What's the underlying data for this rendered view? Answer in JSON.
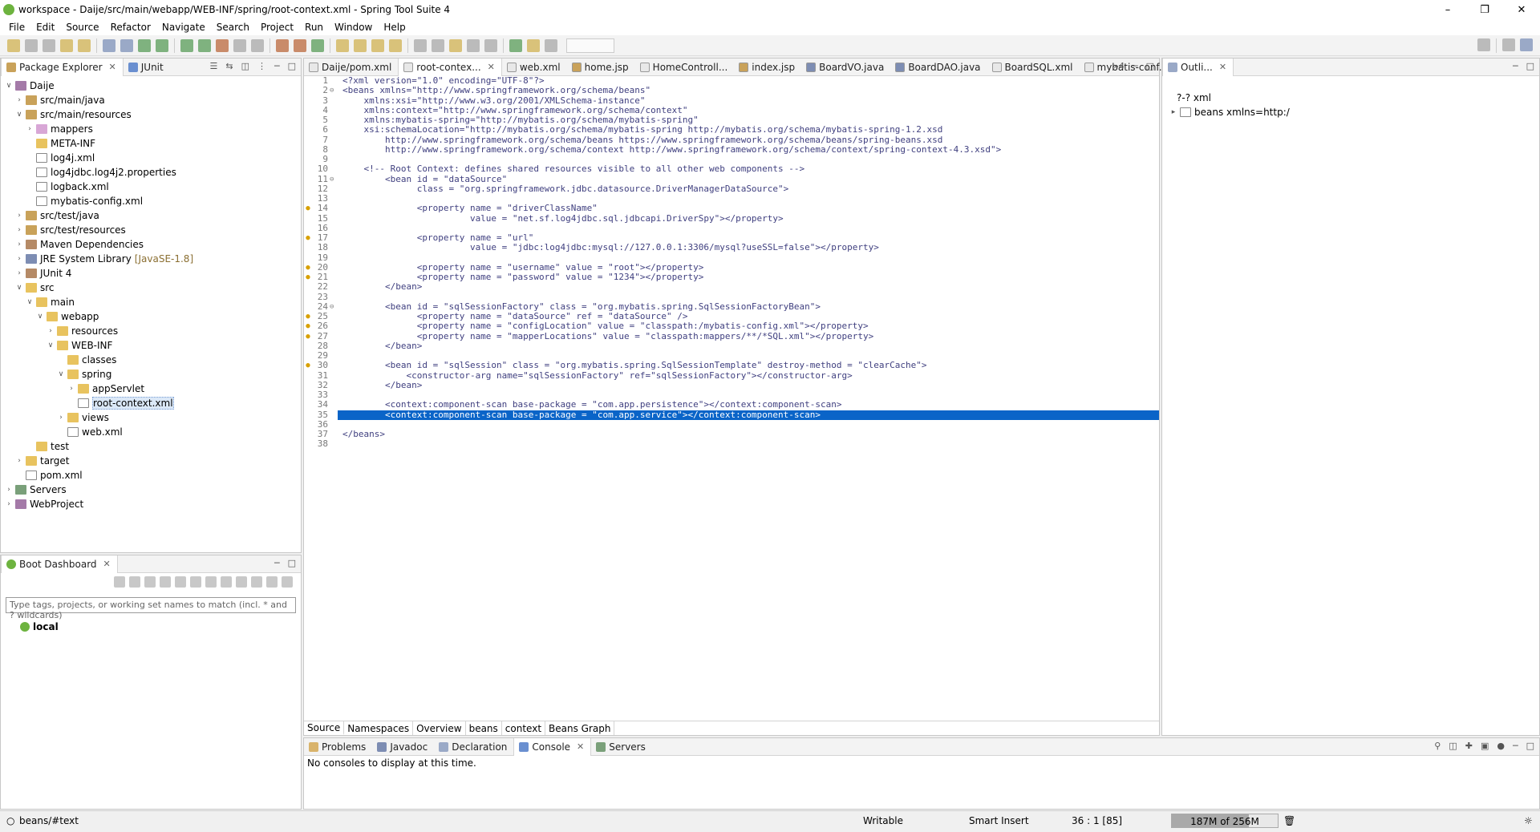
{
  "window": {
    "title": "workspace - Daije/src/main/webapp/WEB-INF/spring/root-context.xml - Spring Tool Suite 4"
  },
  "menu": [
    "File",
    "Edit",
    "Source",
    "Refactor",
    "Navigate",
    "Search",
    "Project",
    "Run",
    "Window",
    "Help"
  ],
  "explorer": {
    "tabs": [
      {
        "label": "Package Explorer"
      },
      {
        "label": "JUnit"
      }
    ],
    "tree": [
      {
        "label": "Daije",
        "indent": 0,
        "icon": "project-icon",
        "twisty": "open"
      },
      {
        "label": "src/main/java",
        "indent": 1,
        "icon": "package-folder-icon",
        "twisty": "closed"
      },
      {
        "label": "src/main/resources",
        "indent": 1,
        "icon": "package-folder-icon",
        "twisty": "open"
      },
      {
        "label": "mappers",
        "indent": 2,
        "icon": "package-icon",
        "twisty": "closed"
      },
      {
        "label": "META-INF",
        "indent": 2,
        "icon": "folder-icon",
        "twisty": ""
      },
      {
        "label": "log4j.xml",
        "indent": 2,
        "icon": "xml-file-icon",
        "twisty": ""
      },
      {
        "label": "log4jdbc.log4j2.properties",
        "indent": 2,
        "icon": "xml-file-icon",
        "twisty": ""
      },
      {
        "label": "logback.xml",
        "indent": 2,
        "icon": "xml-file-icon",
        "twisty": ""
      },
      {
        "label": "mybatis-config.xml",
        "indent": 2,
        "icon": "xml-file-icon",
        "twisty": ""
      },
      {
        "label": "src/test/java",
        "indent": 1,
        "icon": "package-folder-icon",
        "twisty": "closed"
      },
      {
        "label": "src/test/resources",
        "indent": 1,
        "icon": "package-folder-icon",
        "twisty": "closed"
      },
      {
        "label": "Maven Dependencies",
        "indent": 1,
        "icon": "library-icon",
        "twisty": "closed"
      },
      {
        "label": "JRE System Library",
        "decor": "[JavaSE-1.8]",
        "indent": 1,
        "icon": "jre-library-icon",
        "twisty": "closed"
      },
      {
        "label": "JUnit 4",
        "indent": 1,
        "icon": "library-icon",
        "twisty": "closed"
      },
      {
        "label": "src",
        "indent": 1,
        "icon": "folder-icon",
        "twisty": "open"
      },
      {
        "label": "main",
        "indent": 2,
        "icon": "folder-icon",
        "twisty": "open"
      },
      {
        "label": "webapp",
        "indent": 3,
        "icon": "folder-icon",
        "twisty": "open"
      },
      {
        "label": "resources",
        "indent": 4,
        "icon": "folder-icon",
        "twisty": "closed"
      },
      {
        "label": "WEB-INF",
        "indent": 4,
        "icon": "folder-icon",
        "twisty": "open"
      },
      {
        "label": "classes",
        "indent": 5,
        "icon": "folder-icon",
        "twisty": ""
      },
      {
        "label": "spring",
        "indent": 5,
        "icon": "folder-icon",
        "twisty": "open"
      },
      {
        "label": "appServlet",
        "indent": 6,
        "icon": "folder-icon",
        "twisty": "closed"
      },
      {
        "label": "root-context.xml",
        "indent": 6,
        "icon": "xml-file-icon",
        "twisty": "",
        "selected": true
      },
      {
        "label": "views",
        "indent": 5,
        "icon": "folder-icon",
        "twisty": "closed"
      },
      {
        "label": "web.xml",
        "indent": 5,
        "icon": "xml-file-icon",
        "twisty": ""
      },
      {
        "label": "test",
        "indent": 2,
        "icon": "folder-icon",
        "twisty": ""
      },
      {
        "label": "target",
        "indent": 1,
        "icon": "folder-icon",
        "twisty": "closed"
      },
      {
        "label": "pom.xml",
        "indent": 1,
        "icon": "xml-file-icon",
        "twisty": ""
      },
      {
        "label": "Servers",
        "indent": 0,
        "icon": "server-project-icon",
        "twisty": "closed"
      },
      {
        "label": "WebProject",
        "indent": 0,
        "icon": "project-icon",
        "twisty": "closed"
      }
    ]
  },
  "boot": {
    "tab": "Boot Dashboard",
    "search_placeholder": "Type tags, projects, or working set names to match (incl. * and ? wildcards)",
    "local": "local"
  },
  "editor": {
    "tabs": [
      {
        "label": "Daije/pom.xml",
        "active": false
      },
      {
        "label": "root-contex...",
        "active": true
      },
      {
        "label": "web.xml",
        "active": false
      },
      {
        "label": "home.jsp",
        "active": false
      },
      {
        "label": "HomeControll...",
        "active": false
      },
      {
        "label": "index.jsp",
        "active": false
      },
      {
        "label": "BoardVO.java",
        "active": false
      },
      {
        "label": "BoardDAO.java",
        "active": false
      },
      {
        "label": "BoardSQL.xml",
        "active": false
      },
      {
        "label": "mybatis-conf...",
        "active": false
      }
    ],
    "overflow": "»4",
    "lines": [
      {
        "n": "1",
        "m": "",
        "t": "<?xml version=\"1.0\" encoding=\"UTF-8\"?>"
      },
      {
        "n": "2",
        "m": "fold",
        "t": "<beans xmlns=\"http://www.springframework.org/schema/beans\""
      },
      {
        "n": "3",
        "m": "",
        "t": "    xmlns:xsi=\"http://www.w3.org/2001/XMLSchema-instance\""
      },
      {
        "n": "4",
        "m": "",
        "t": "    xmlns:context=\"http://www.springframework.org/schema/context\""
      },
      {
        "n": "5",
        "m": "",
        "t": "    xmlns:mybatis-spring=\"http://mybatis.org/schema/mybatis-spring\""
      },
      {
        "n": "6",
        "m": "",
        "t": "    xsi:schemaLocation=\"http://mybatis.org/schema/mybatis-spring http://mybatis.org/schema/mybatis-spring-1.2.xsd"
      },
      {
        "n": "7",
        "m": "",
        "t": "        http://www.springframework.org/schema/beans https://www.springframework.org/schema/beans/spring-beans.xsd"
      },
      {
        "n": "8",
        "m": "",
        "t": "        http://www.springframework.org/schema/context http://www.springframework.org/schema/context/spring-context-4.3.xsd\">"
      },
      {
        "n": "9",
        "m": "",
        "t": ""
      },
      {
        "n": "10",
        "m": "",
        "t": "    <!-- Root Context: defines shared resources visible to all other web components -->"
      },
      {
        "n": "11",
        "m": "fold",
        "t": "        <bean id = \"dataSource\""
      },
      {
        "n": "12",
        "m": "",
        "t": "              class = \"org.springframework.jdbc.datasource.DriverManagerDataSource\">"
      },
      {
        "n": "13",
        "m": "",
        "t": ""
      },
      {
        "n": "14",
        "m": "warn",
        "t": "              <property name = \"driverClassName\""
      },
      {
        "n": "15",
        "m": "",
        "t": "                        value = \"net.sf.log4jdbc.sql.jdbcapi.DriverSpy\"></property>"
      },
      {
        "n": "16",
        "m": "",
        "t": ""
      },
      {
        "n": "17",
        "m": "warn",
        "t": "              <property name = \"url\""
      },
      {
        "n": "18",
        "m": "",
        "t": "                        value = \"jdbc:log4jdbc:mysql://127.0.0.1:3306/mysql?useSSL=false\"></property>"
      },
      {
        "n": "19",
        "m": "",
        "t": ""
      },
      {
        "n": "20",
        "m": "warn",
        "t": "              <property name = \"username\" value = \"root\"></property>"
      },
      {
        "n": "21",
        "m": "warn",
        "t": "              <property name = \"password\" value = \"1234\"></property>"
      },
      {
        "n": "22",
        "m": "",
        "t": "        </bean>"
      },
      {
        "n": "23",
        "m": "",
        "t": ""
      },
      {
        "n": "24",
        "m": "fold",
        "t": "        <bean id = \"sqlSessionFactory\" class = \"org.mybatis.spring.SqlSessionFactoryBean\">"
      },
      {
        "n": "25",
        "m": "warn",
        "t": "              <property name = \"dataSource\" ref = \"dataSource\" />"
      },
      {
        "n": "26",
        "m": "warn",
        "t": "              <property name = \"configLocation\" value = \"classpath:/mybatis-config.xml\"></property>"
      },
      {
        "n": "27",
        "m": "warn",
        "t": "              <property name = \"mapperLocations\" value = \"classpath:mappers/**/*SQL.xml\"></property>"
      },
      {
        "n": "28",
        "m": "",
        "t": "        </bean>"
      },
      {
        "n": "29",
        "m": "",
        "t": ""
      },
      {
        "n": "30",
        "m": "warn",
        "t": "        <bean id = \"sqlSession\" class = \"org.mybatis.spring.SqlSessionTemplate\" destroy-method = \"clearCache\">"
      },
      {
        "n": "31",
        "m": "",
        "t": "            <constructor-arg name=\"sqlSessionFactory\" ref=\"sqlSessionFactory\"></constructor-arg>"
      },
      {
        "n": "32",
        "m": "",
        "t": "        </bean>"
      },
      {
        "n": "33",
        "m": "",
        "t": ""
      },
      {
        "n": "34",
        "m": "",
        "t": "        <context:component-scan base-package = \"com.app.persistence\"></context:component-scan>"
      },
      {
        "n": "35",
        "m": "",
        "t": "        <context:component-scan base-package = \"com.app.service\"></context:component-scan>",
        "hl": true
      },
      {
        "n": "36",
        "m": "",
        "t": ""
      },
      {
        "n": "37",
        "m": "",
        "t": "</beans>"
      },
      {
        "n": "38",
        "m": "",
        "t": ""
      }
    ],
    "bottom_tabs": [
      "Source",
      "Namespaces",
      "Overview",
      "beans",
      "context",
      "Beans Graph"
    ]
  },
  "outline": {
    "tab": "Outli...",
    "items": [
      {
        "label": "?-? xml"
      },
      {
        "label": "beans xmlns=http:/"
      }
    ]
  },
  "console": {
    "tabs": [
      {
        "label": "Problems"
      },
      {
        "label": "Javadoc"
      },
      {
        "label": "Declaration"
      },
      {
        "label": "Console",
        "active": true
      },
      {
        "label": "Servers"
      }
    ],
    "message": "No consoles to display at this time."
  },
  "status": {
    "path": "beans/#text",
    "writable": "Writable",
    "insert": "Smart Insert",
    "position": "36 : 1 [85]",
    "memory": "187M of 256M",
    "memory_fraction": 0.73
  }
}
